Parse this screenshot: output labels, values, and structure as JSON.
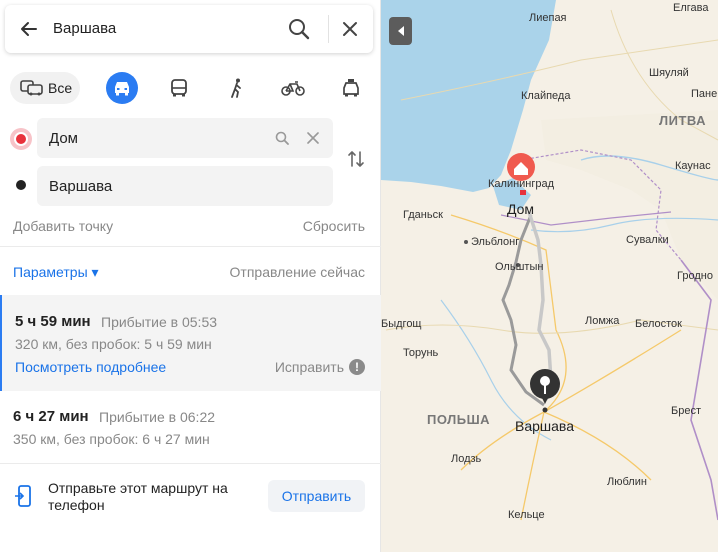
{
  "search": {
    "query": "Варшава"
  },
  "modes": {
    "all_label": "Все"
  },
  "points": {
    "from": "Дом",
    "to": "Варшава"
  },
  "actions": {
    "add_point": "Добавить точку",
    "reset": "Сбросить"
  },
  "params": {
    "label": "Параметры ▾",
    "departure": "Отправление сейчас"
  },
  "routes": [
    {
      "time": "5 ч 59 мин",
      "arrival": "Прибытие в 05:53",
      "distance": "320 км, без пробок: 5 ч 59 мин",
      "details": "Посмотреть подробнее",
      "fix": "Исправить"
    },
    {
      "time": "6 ч 27 мин",
      "arrival": "Прибытие в 06:22",
      "distance": "350 км, без пробок: 6 ч 27 мин"
    }
  ],
  "send": {
    "text": "Отправьте этот маршрут на телефон",
    "button": "Отправить"
  },
  "map": {
    "labels": {
      "liepaja": "Лиепая",
      "jelgava": "Елгава",
      "siauliai": "Шяуляй",
      "panevezys": "Панев",
      "klaipeda": "Клайпеда",
      "lithuania": "ЛИТВА",
      "kaunas": "Каунас",
      "kaliningrad": "Калининград",
      "home": "Дом",
      "gdansk": "Гданьск",
      "elblag": "Эльблонг",
      "suwalki": "Сувалки",
      "olsztyn": "Ольштын",
      "grodno": "Гродно",
      "bydgoszcz": "Быдгощ",
      "lomza": "Ломжа",
      "bialystok": "Белосток",
      "torun": "Торунь",
      "poland": "ПОЛЬША",
      "warsaw": "Варшава",
      "brest": "Брест",
      "lodz": "Лодзь",
      "lublin": "Люблин",
      "kielce": "Кельце"
    }
  }
}
